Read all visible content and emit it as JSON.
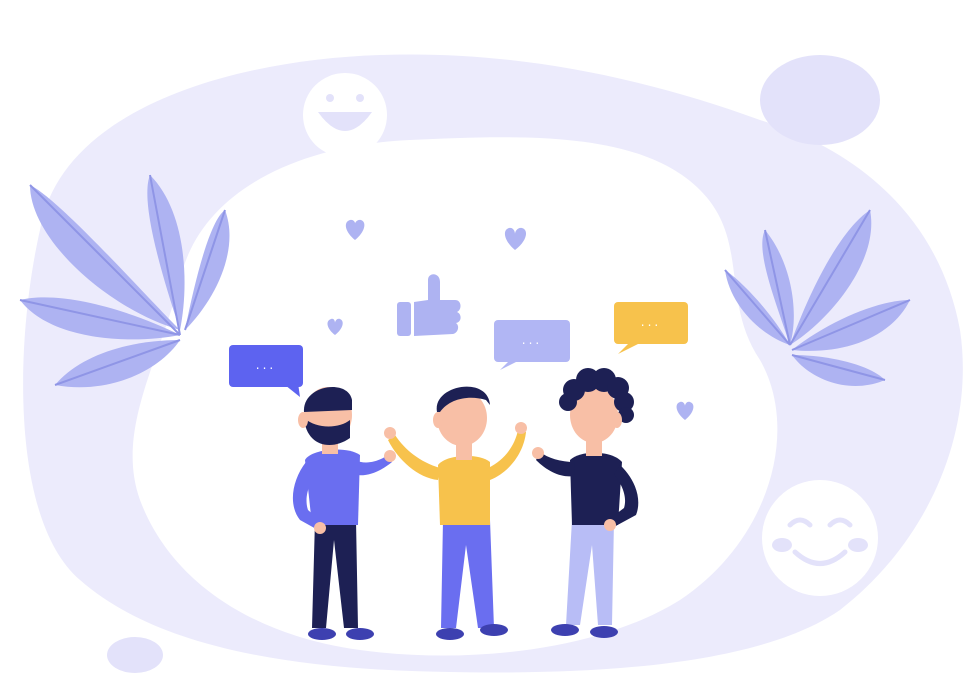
{
  "illustration": {
    "palette": {
      "background": "#ffffff",
      "blob_outer": "#ecebfc",
      "blob_mid": "#e3e2fa",
      "blob_inner": "#ffffff",
      "leaf": "#aeb3f2",
      "leaf_vein": "#8f95e6",
      "smiley": "#ffffff",
      "smiley_feature": "#e3e2fa",
      "heart": "#aeb3f2",
      "thumb": "#aeb3f2",
      "bubble_blue": "#5d63f0",
      "bubble_lavender": "#b1b6f4",
      "bubble_yellow": "#f7c24c",
      "skin": "#f8bfa6",
      "hair": "#1d2054",
      "shirt_blue": "#6a6ef0",
      "shirt_yellow": "#f7c24c",
      "shirt_navy": "#1d2054",
      "pants_navy": "#1d2054",
      "pants_blue": "#6a6ef0",
      "pants_light": "#b8bdf6",
      "shoe": "#3d40b0"
    },
    "bubble_text": "..."
  }
}
